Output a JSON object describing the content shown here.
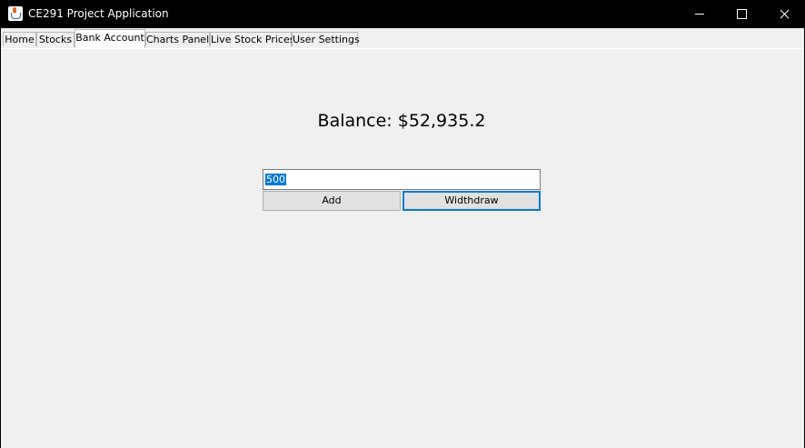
{
  "window": {
    "title": "CE291 Project Application",
    "icon": "java-cup-icon"
  },
  "tabs": [
    {
      "label": "Home",
      "selected": false
    },
    {
      "label": "Stocks",
      "selected": false
    },
    {
      "label": "Bank Account",
      "selected": true
    },
    {
      "label": "Charts Panel",
      "selected": false
    },
    {
      "label": "Live Stock Prices",
      "selected": false
    },
    {
      "label": "User Settings",
      "selected": false
    }
  ],
  "bank": {
    "balance_text": "Balance: $52,935.2",
    "amount_value": "500",
    "add_label": "Add",
    "withdraw_label": "Widthdraw"
  },
  "colors": {
    "focus_accent": "#0078d7",
    "panel_background": "#f0f0f0",
    "titlebar_background": "#000000"
  }
}
